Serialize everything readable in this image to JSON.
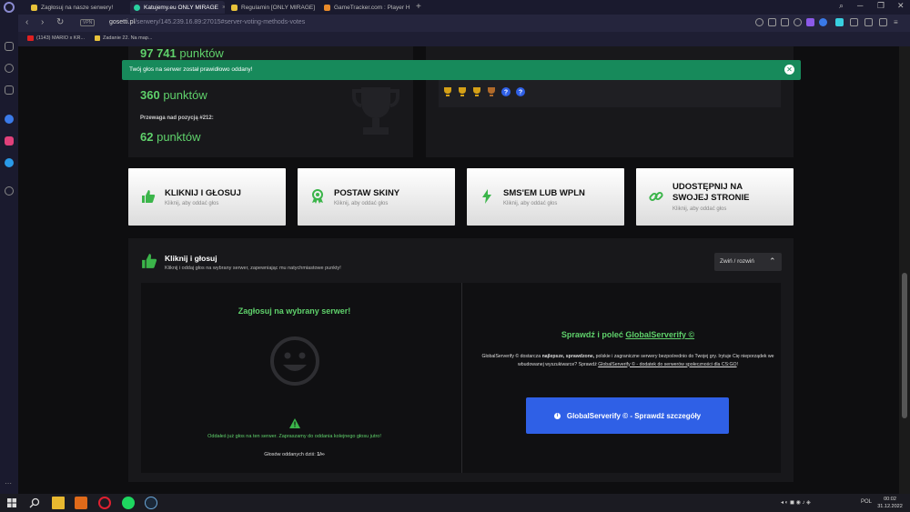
{
  "browser": {
    "tabs": [
      {
        "label": "Zagłosuj na nasze serwery!",
        "active": false
      },
      {
        "label": "Katujemy.eu ONLY MIRAGE",
        "active": true
      },
      {
        "label": "Regulamin [ONLY MIRAGE]",
        "active": false
      },
      {
        "label": "GameTracker.com : Player H",
        "active": false
      }
    ],
    "url_host": "gosetti.pl",
    "url_path": "/serwery/145.239.16.89:27015#server-voting-methods-votes",
    "vpn_label": "VPN",
    "bookmarks": [
      "(1143) MARIO x KR...",
      "Zadanie 22. Na map..."
    ]
  },
  "stats": {
    "top_points": "97 741",
    "mid_points": "360",
    "advantage_label": "Przewaga nad pozycją #212:",
    "advantage_points": "62",
    "unit": "punktów"
  },
  "alert": {
    "message": "Twój głos na serwer został prawidłowo oddany!"
  },
  "cards": [
    {
      "title": "KLIKNIJ I GŁOSUJ",
      "subtitle": "Kliknij, aby oddać głos",
      "icon": "thumbs-up-icon"
    },
    {
      "title": "POSTAW SKINY",
      "subtitle": "Kliknij, aby oddać głos",
      "icon": "award-icon"
    },
    {
      "title": "SMS'EM LUB WPLN",
      "subtitle": "Kliknij, aby oddać głos",
      "icon": "bolt-icon"
    },
    {
      "title": "UDOSTĘPNIJ NA SWOJEJ STRONIE",
      "subtitle": "Kliknij, aby oddać głos",
      "icon": "link-icon"
    }
  ],
  "section": {
    "title": "Kliknij i głosuj",
    "subtitle": "Kliknij i oddaj głos na wybrany serwer, zapewniając mu natychmiastowe punkty!",
    "toggle_label": "Zwiń / rozwiń"
  },
  "vote": {
    "heading": "Zagłosuj na wybrany serwer!",
    "message": "Oddałeś już głos na ten serwer. Zapraszamy do oddania kolejnego głosu jutro!",
    "votes_today_label": "Głosów oddanych dziś:",
    "votes_today_value": "1/∞"
  },
  "serverify": {
    "heading_prefix": "Sprawdź i poleć",
    "heading_link": "GlobalServerify ©",
    "desc_part1": "GlobalServerify © dostarcza ",
    "desc_bold": "najlepsze, sprawdzone,",
    "desc_part2": " polskie i zagraniczne serwery bezpośrednio do Twojej gry. Irytuje Cię nieporządek we wbudowanej wyszukiwarce? Sprawdź ",
    "desc_link": "GlobalServerify © - dodatek do serwerów społeczności dla CS:GO",
    "desc_end": "!",
    "button_label": "GlobalServerify © - Sprawdź szczegóły"
  },
  "taskbar": {
    "time": "00:02",
    "date": "31.12.2022",
    "lang": "POL"
  },
  "colors": {
    "accent_green": "#5fd16b",
    "alert_green": "#178a5b",
    "button_blue": "#2f60e6",
    "trophy_gold": "#d4a017",
    "trophy_bronze": "#b06a2a",
    "question_blue": "#2f60e6"
  }
}
